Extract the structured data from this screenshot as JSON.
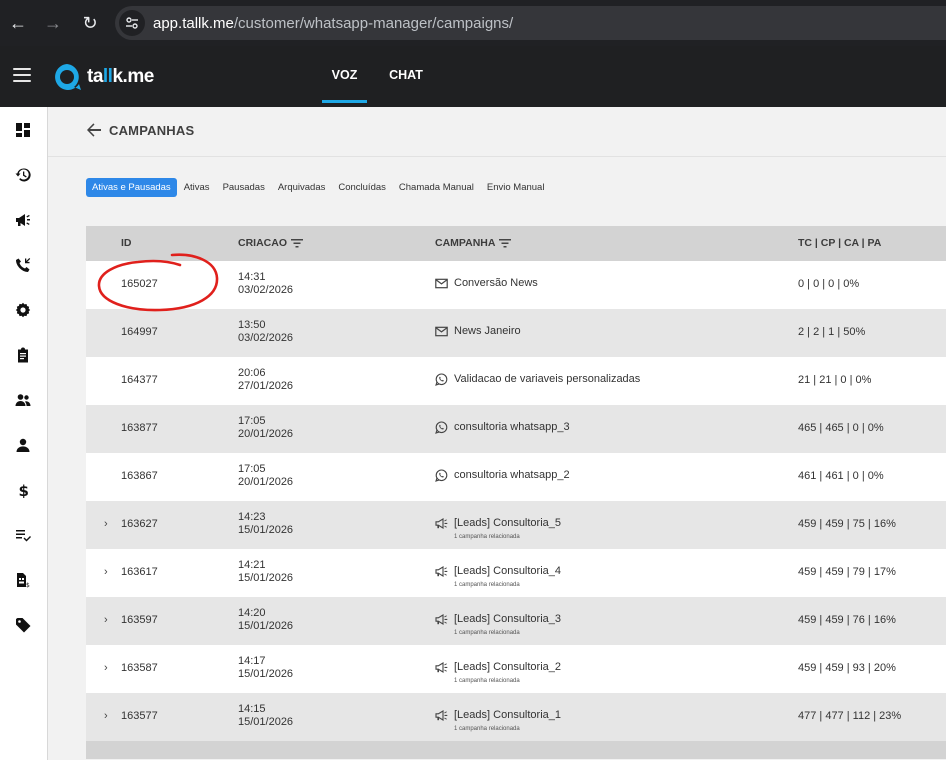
{
  "browser": {
    "back": "←",
    "forward": "→",
    "reload": "↻",
    "url_host": "app.tallk.me",
    "url_path": "/customer/whatsapp-manager/campaigns/"
  },
  "header": {
    "logo_text_a": "ta",
    "logo_text_b": "ll",
    "logo_text_c": "k.me",
    "tabs": [
      {
        "label": "VOZ",
        "active": true
      },
      {
        "label": "CHAT",
        "active": false
      }
    ],
    "accent_color": "#1ea8e6"
  },
  "sidebar": {
    "icons": [
      "dashboard-icon",
      "history-icon",
      "campaign-icon",
      "phone-callback-icon",
      "settings-icon",
      "clipboard-icon",
      "group-icon",
      "person-icon",
      "dollar-icon",
      "checklist-icon",
      "sim-card-icon",
      "tag-icon"
    ]
  },
  "page": {
    "title": "CAMPANHAS"
  },
  "filters": [
    {
      "label": "Ativas e Pausadas",
      "active": true
    },
    {
      "label": "Ativas",
      "active": false
    },
    {
      "label": "Pausadas",
      "active": false
    },
    {
      "label": "Arquivadas",
      "active": false
    },
    {
      "label": "Concluídas",
      "active": false
    },
    {
      "label": "Chamada Manual",
      "active": false
    },
    {
      "label": "Envio Manual",
      "active": false
    }
  ],
  "table": {
    "columns": {
      "id": "ID",
      "created": "CRIACAO",
      "campaign": "CAMPANHA",
      "stats": "TC | CP | CA | PA"
    },
    "rows": [
      {
        "id": "165027",
        "time": "14:31",
        "date": "03/02/2026",
        "icon": "email-icon",
        "name": "Conversão News",
        "sub": "",
        "stats": "0 | 0 | 0 | 0%",
        "expandable": false
      },
      {
        "id": "164997",
        "time": "13:50",
        "date": "03/02/2026",
        "icon": "email-icon",
        "name": "News Janeiro",
        "sub": "",
        "stats": "2 | 2 | 1 | 50%",
        "expandable": false
      },
      {
        "id": "164377",
        "time": "20:06",
        "date": "27/01/2026",
        "icon": "whatsapp-icon",
        "name": "Validacao de variaveis personalizadas",
        "sub": "",
        "stats": "21 | 21 | 0 | 0%",
        "expandable": false
      },
      {
        "id": "163877",
        "time": "17:05",
        "date": "20/01/2026",
        "icon": "whatsapp-icon",
        "name": "consultoria whatsapp_3",
        "sub": "",
        "stats": "465 | 465 | 0 | 0%",
        "expandable": false
      },
      {
        "id": "163867",
        "time": "17:05",
        "date": "20/01/2026",
        "icon": "whatsapp-icon",
        "name": "consultoria whatsapp_2",
        "sub": "",
        "stats": "461 | 461 | 0 | 0%",
        "expandable": false
      },
      {
        "id": "163627",
        "time": "14:23",
        "date": "15/01/2026",
        "icon": "megaphone-icon",
        "name": "[Leads] Consultoria_5",
        "sub": "1 campanha relacionada",
        "stats": "459 | 459 | 75 | 16%",
        "expandable": true
      },
      {
        "id": "163617",
        "time": "14:21",
        "date": "15/01/2026",
        "icon": "megaphone-icon",
        "name": "[Leads] Consultoria_4",
        "sub": "1 campanha relacionada",
        "stats": "459 | 459 | 79 | 17%",
        "expandable": true
      },
      {
        "id": "163597",
        "time": "14:20",
        "date": "15/01/2026",
        "icon": "megaphone-icon",
        "name": "[Leads] Consultoria_3",
        "sub": "1 campanha relacionada",
        "stats": "459 | 459 | 76 | 16%",
        "expandable": true
      },
      {
        "id": "163587",
        "time": "14:17",
        "date": "15/01/2026",
        "icon": "megaphone-icon",
        "name": "[Leads] Consultoria_2",
        "sub": "1 campanha relacionada",
        "stats": "459 | 459 | 93 | 20%",
        "expandable": true
      },
      {
        "id": "163577",
        "time": "14:15",
        "date": "15/01/2026",
        "icon": "megaphone-icon",
        "name": "[Leads] Consultoria_1",
        "sub": "1 campanha relacionada",
        "stats": "477 | 477 | 112 | 23%",
        "expandable": true
      }
    ]
  },
  "annotation": {
    "color": "#e0201c"
  }
}
